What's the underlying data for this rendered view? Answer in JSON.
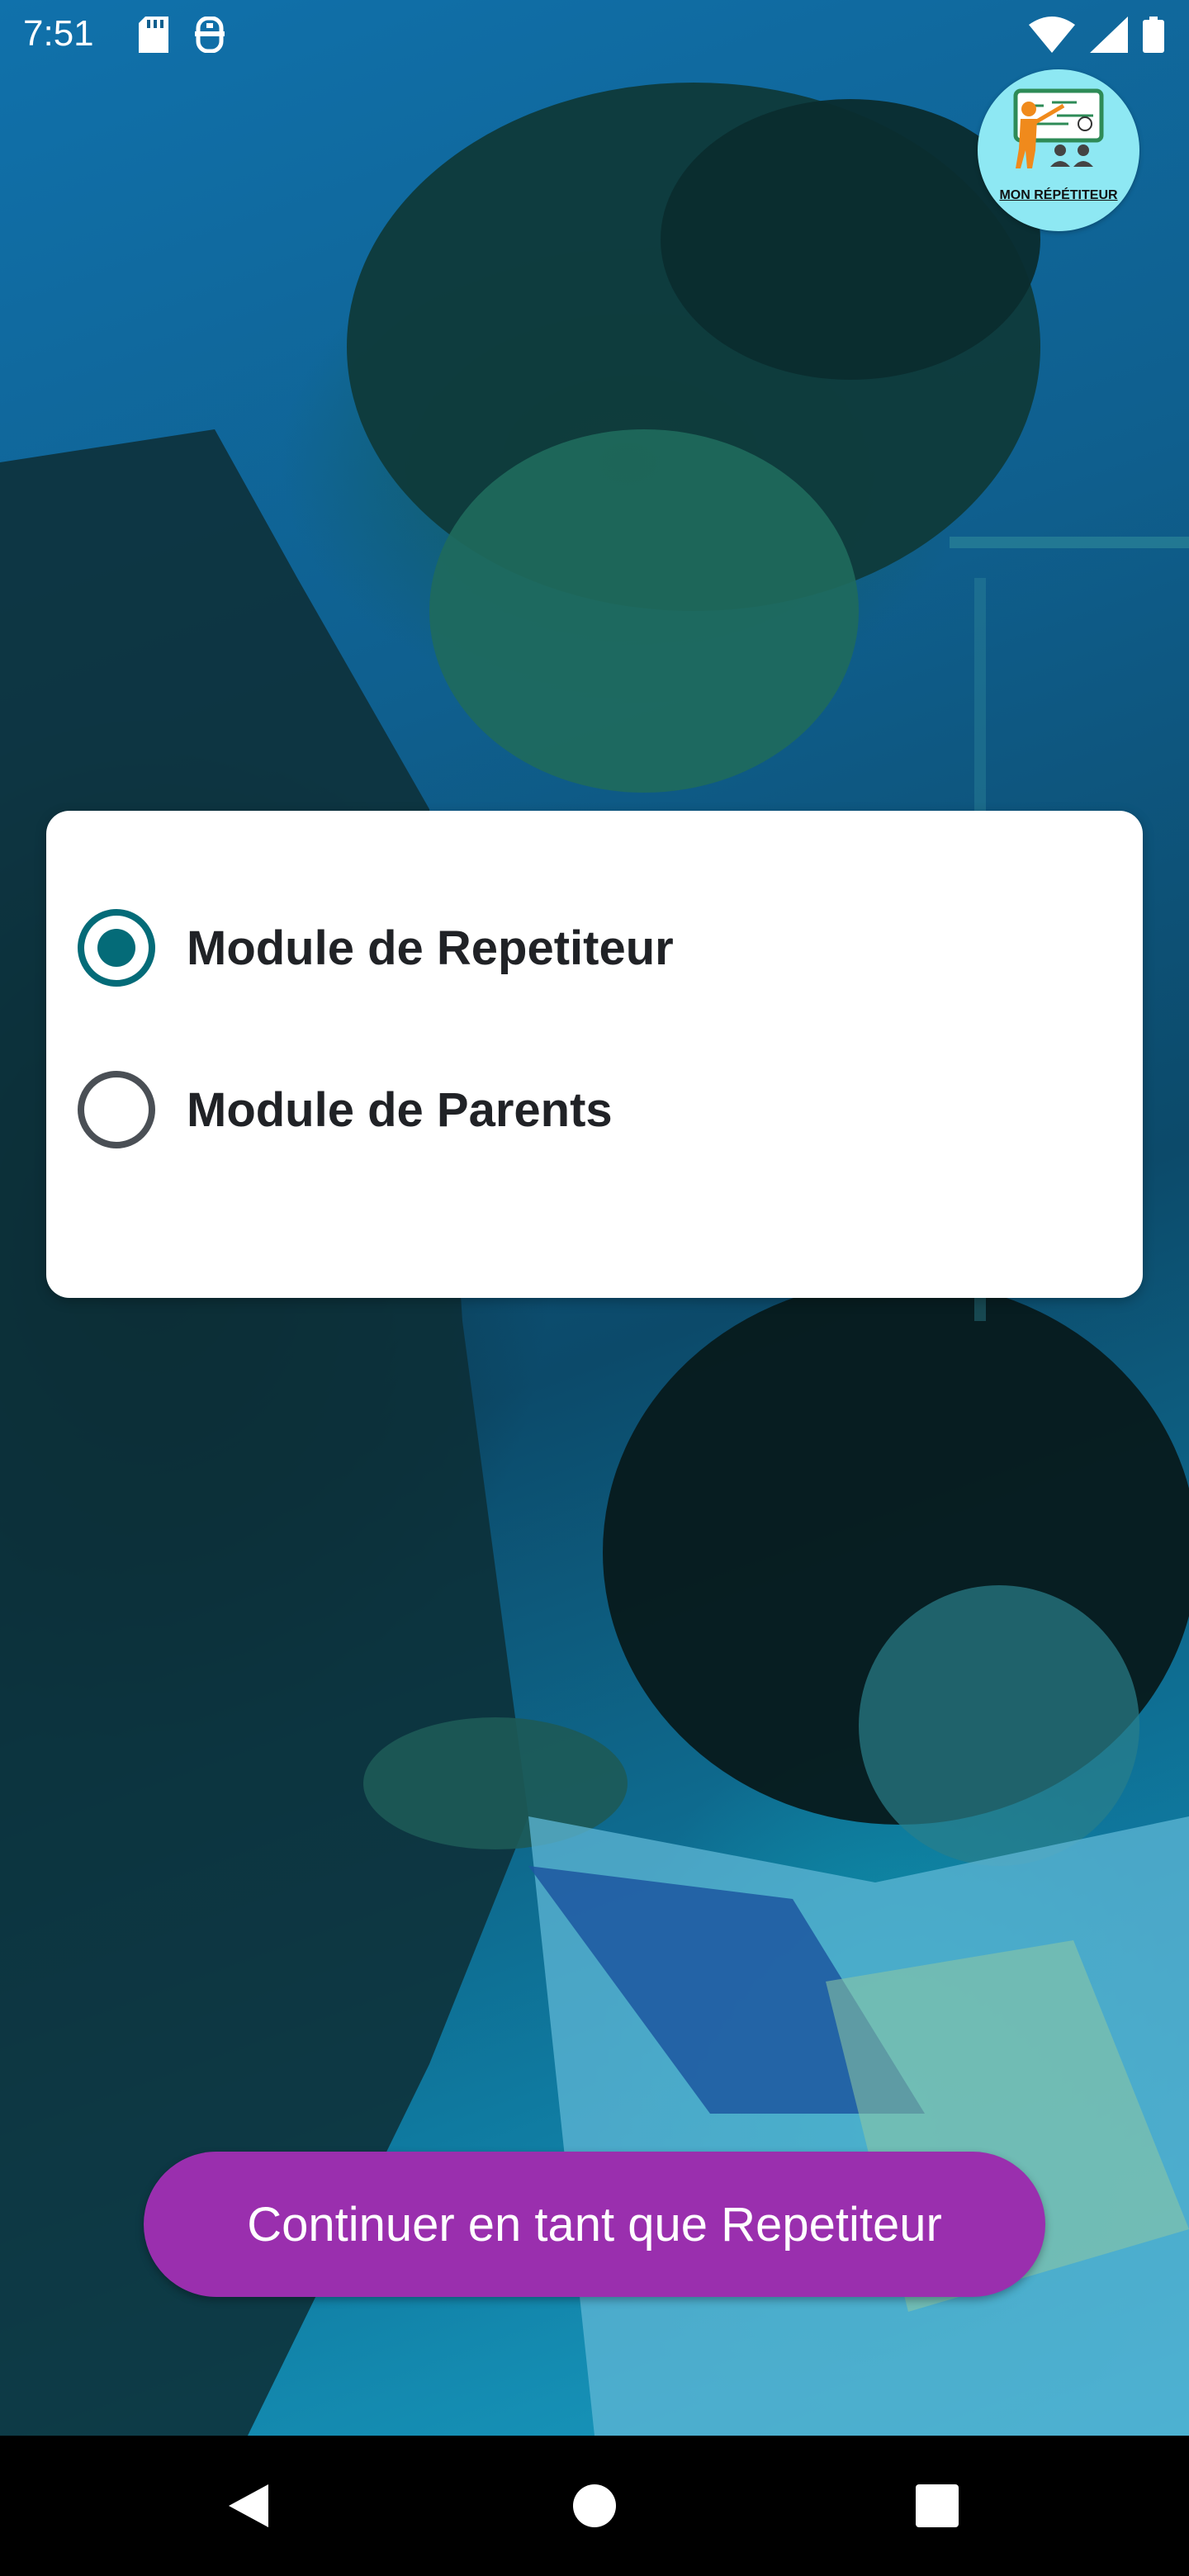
{
  "status_bar": {
    "time": "7:51",
    "left_icons": [
      "sd-card-icon",
      "usb-icon"
    ],
    "right_icons": [
      "wifi-icon",
      "cellular-signal-icon",
      "battery-icon"
    ]
  },
  "logo": {
    "text": "MON RÉPÉTITEUR"
  },
  "module_selector": {
    "options": [
      {
        "label": "Module de Repetiteur",
        "selected": true
      },
      {
        "label": "Module de Parents",
        "selected": false
      }
    ]
  },
  "continue_button": {
    "label": "Continuer en tant que Repetiteur"
  },
  "nav_bar": {
    "buttons": [
      "back-icon",
      "home-icon",
      "recents-icon"
    ]
  },
  "colors": {
    "accent_radio": "#046b78",
    "button": "#9a2fae",
    "card": "#ffffff"
  }
}
